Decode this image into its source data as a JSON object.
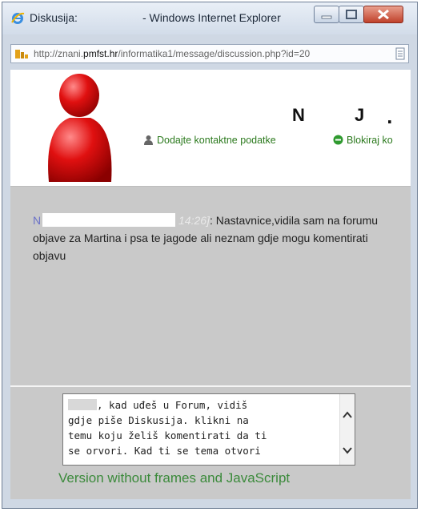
{
  "window": {
    "title": "Diskusija:",
    "app_name": "- Windows Internet Explorer",
    "controls": {
      "minimize": "minimize",
      "maximize": "maximize",
      "close": "close"
    }
  },
  "address_bar": {
    "url_prefix": "http://znani.",
    "url_domain": "pmfst.hr",
    "url_path": "/informatika1/message/discussion.php?id=20"
  },
  "profile": {
    "name_part1": "N",
    "name_part2": "J",
    "name_dot": ".",
    "actions": {
      "add_contact": "Dodajte kontaktne podatke",
      "block": "Blokiraj ko"
    }
  },
  "message": {
    "author_initial": "N",
    "time": "14:26]",
    "colon": ":",
    "text": " Nastavnice,vidila sam na forumu objave za Martina i psa te jagode ali neznam gdje mogu komentirati objavu"
  },
  "compose": {
    "line1": ", kad uđeš u Forum, vidiš",
    "line2": "gdje piše Diskusija. klikni na",
    "line3": "temu koju želiš komentirati da ti",
    "line4": "se orvori. Kad ti se tema otvori"
  },
  "footer": {
    "version_link": "Version without frames and JavaScript"
  },
  "colors": {
    "link_green": "#3b8a3b",
    "author_blue": "#6b72c8",
    "avatar_red": "#e01010"
  }
}
